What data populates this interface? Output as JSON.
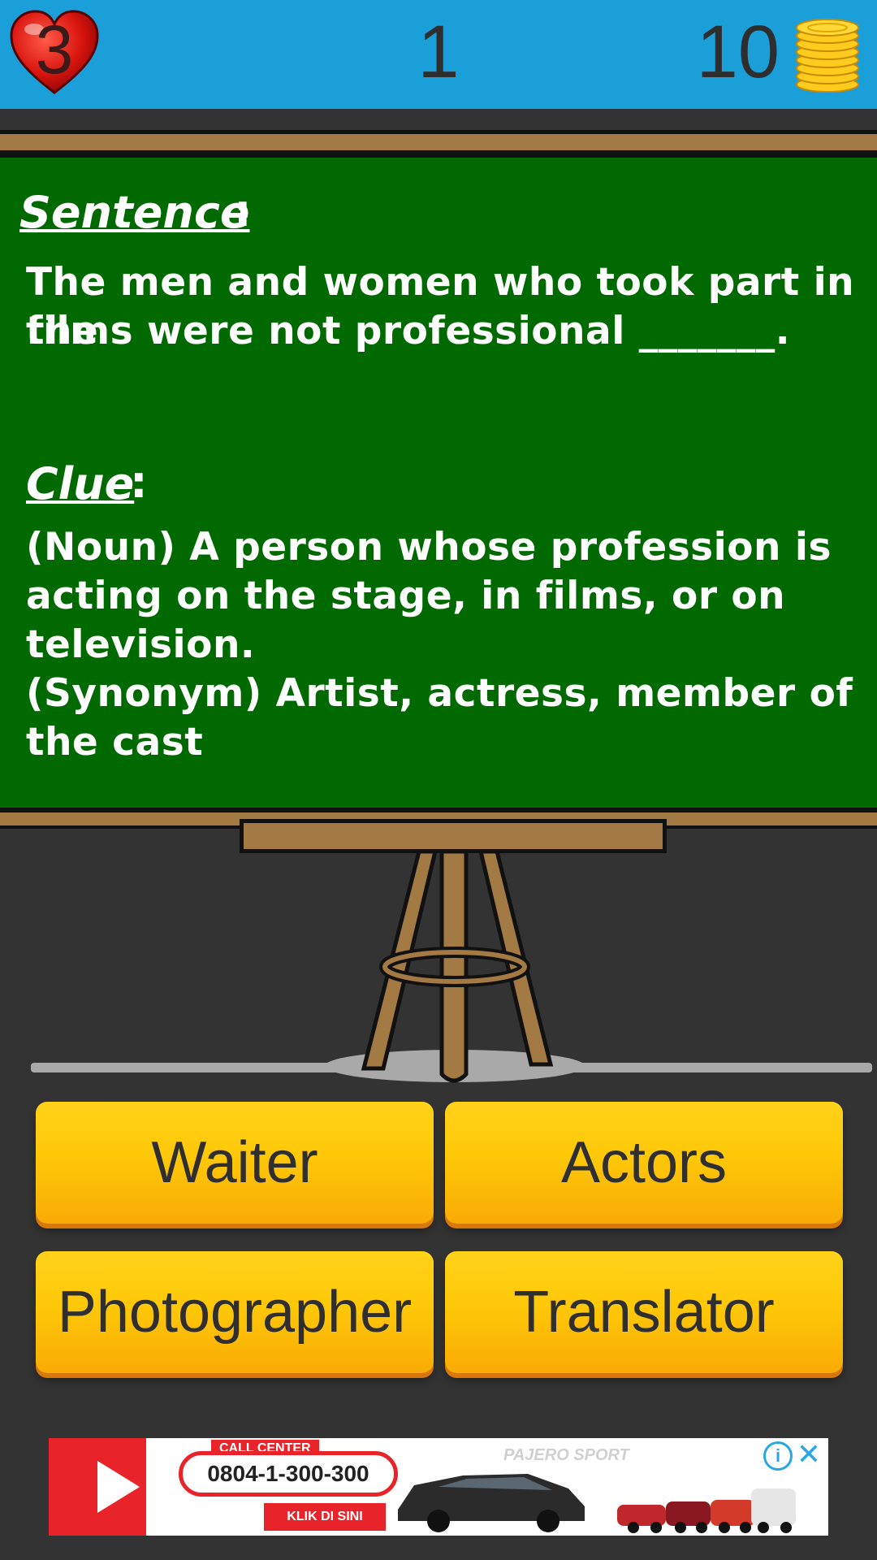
{
  "header": {
    "lives": "3",
    "level": "1",
    "coins": "10"
  },
  "board": {
    "sentence_heading": "Sentence",
    "sentence_colon": ":",
    "sentence_line1": "The men and women who took part in the",
    "sentence_line2": "films were not professional _______.",
    "clue_heading": "Clue",
    "clue_colon": ":",
    "clue_line1": "(Noun) A person whose profession is",
    "clue_line2": "acting on the stage, in films, or on",
    "clue_line3": "television.",
    "clue_line4": "(Synonym) Artist, actress, member of",
    "clue_line5": "the cast"
  },
  "answers": [
    "Waiter",
    "Actors",
    "Photographer",
    "Translator"
  ],
  "ad": {
    "call_center": "CALL CENTER",
    "phone": "0804-1-300-300",
    "cta": "KLIK DI SINI",
    "model": "PAJERO SPORT",
    "info": "i",
    "close": "✕"
  },
  "colors": {
    "topbar": "#1b9fd8",
    "board": "#006a00",
    "wood": "#a37a44",
    "button": "#ffc808"
  },
  "icons": [
    "heart-icon",
    "coin-stack-icon",
    "info-icon",
    "close-icon"
  ]
}
